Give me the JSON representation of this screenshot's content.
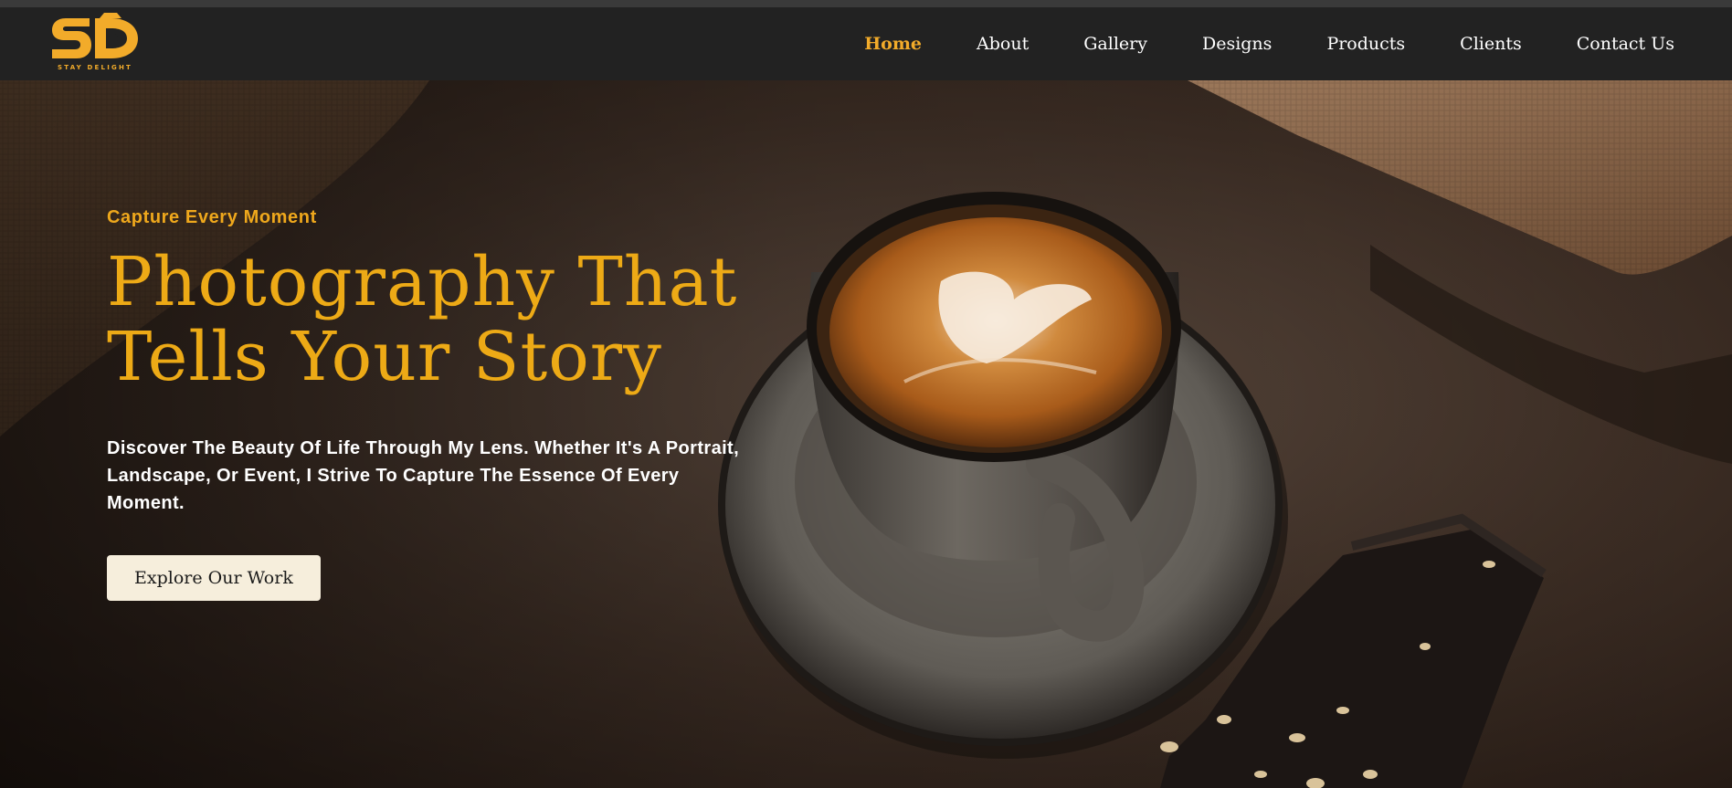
{
  "brand": {
    "logo_monogram": "SD",
    "logo_tagline": "STAY DELIGHT",
    "accent_color": "#f2ab2a"
  },
  "nav": {
    "items": [
      {
        "label": "Home",
        "active": true
      },
      {
        "label": "About"
      },
      {
        "label": "Gallery"
      },
      {
        "label": "Designs"
      },
      {
        "label": "Products"
      },
      {
        "label": "Clients"
      },
      {
        "label": "Contact Us"
      }
    ]
  },
  "hero": {
    "eyebrow": "Capture Every Moment",
    "headline_line1": "Photography That",
    "headline_line2": "Tells Your Story",
    "description": "Discover The Beauty Of Life Through My Lens. Whether It's A Portrait, Landscape, Or Event, I Strive To Capture The Essence Of Every Moment.",
    "cta_label": "Explore Our Work"
  }
}
